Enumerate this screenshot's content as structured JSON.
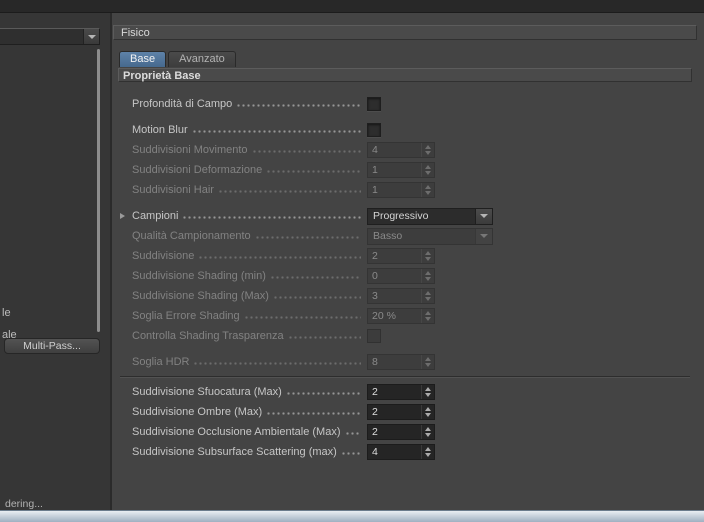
{
  "sidebar": {
    "list_fragments": [
      "le",
      "ale"
    ],
    "multipass_button": "Multi-Pass...",
    "bottom_fragment": "dering..."
  },
  "panel": {
    "title": "Fisico",
    "tabs": [
      {
        "label": "Base",
        "active": true
      },
      {
        "label": "Avanzato",
        "active": false
      }
    ],
    "group_header": "Proprietà Base",
    "rows": [
      {
        "label": "Profondità di Campo",
        "type": "checkbox",
        "checked": false,
        "enabled": true
      },
      {
        "label": "Motion Blur",
        "type": "checkbox",
        "checked": false,
        "enabled": true
      },
      {
        "label": "Suddivisioni Movimento",
        "type": "spinner",
        "value": "4",
        "enabled": false
      },
      {
        "label": "Suddivisioni Deformazione",
        "type": "spinner",
        "value": "1",
        "enabled": false
      },
      {
        "label": "Suddivisioni Hair",
        "type": "spinner",
        "value": "1",
        "enabled": false
      },
      {
        "label": "Campioni",
        "type": "dropdown",
        "value": "Progressivo",
        "enabled": true,
        "expandable": true
      },
      {
        "label": "Qualità Campionamento",
        "type": "dropdown",
        "value": "Basso",
        "enabled": false
      },
      {
        "label": "Suddivisione",
        "type": "spinner",
        "value": "2",
        "enabled": false
      },
      {
        "label": "Suddivisione Shading (min)",
        "type": "spinner",
        "value": "0",
        "enabled": false
      },
      {
        "label": "Suddivisione Shading (Max)",
        "type": "spinner",
        "value": "3",
        "enabled": false
      },
      {
        "label": "Soglia Errore Shading",
        "type": "spinner",
        "value": "20 %",
        "enabled": false
      },
      {
        "label": "Controlla Shading Trasparenza",
        "type": "checkbox",
        "checked": false,
        "enabled": false
      },
      {
        "label": "Soglia HDR",
        "type": "spinner",
        "value": "8",
        "enabled": false
      },
      {
        "label": "Suddivisione Sfuocatura (Max)",
        "type": "spinner",
        "value": "2",
        "enabled": true
      },
      {
        "label": "Suddivisione Ombre (Max)",
        "type": "spinner",
        "value": "2",
        "enabled": true
      },
      {
        "label": "Suddivisione Occlusione Ambientale (Max)",
        "type": "spinner",
        "value": "2",
        "enabled": true
      },
      {
        "label": "Suddivisione Subsurface Scattering (max)",
        "type": "spinner",
        "value": "4",
        "enabled": true
      }
    ]
  },
  "colors": {
    "panel_bg": "#444444",
    "sidebar_bg": "#363636",
    "active_tab": "#46698e",
    "field_bg": "#252525",
    "disabled_text": "#828282"
  }
}
